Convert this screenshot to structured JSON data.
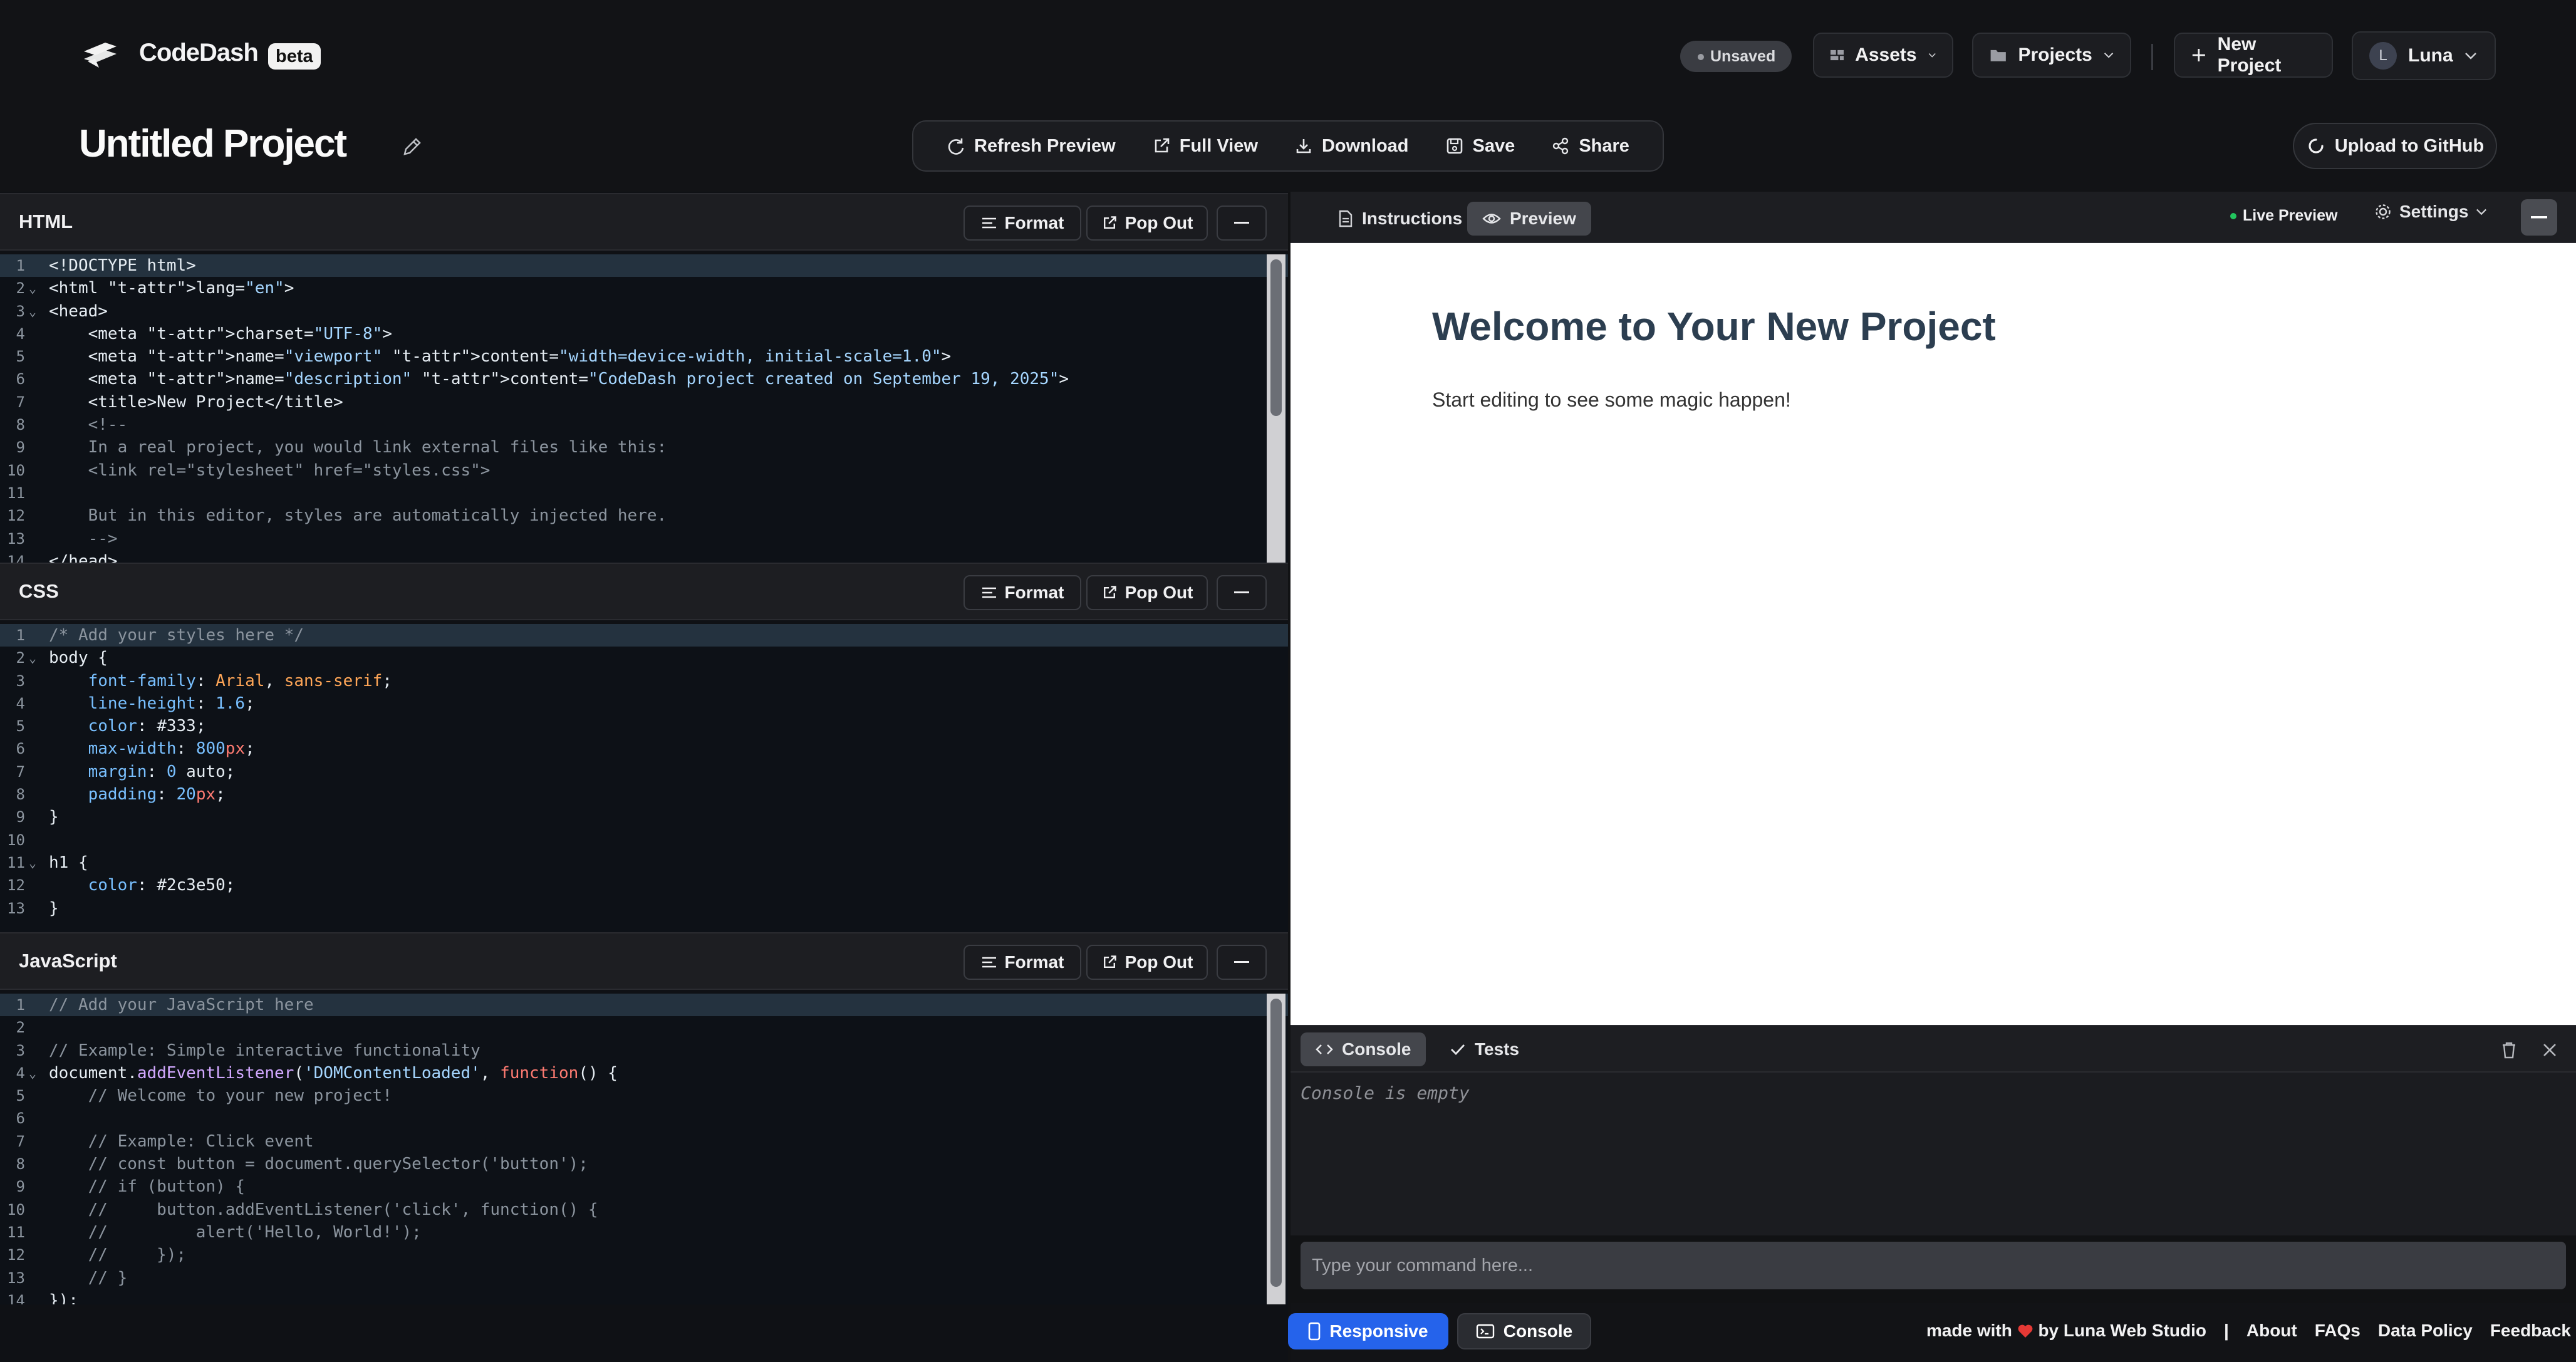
{
  "header": {
    "brand": "CodeDash",
    "beta": "beta",
    "status": "Unsaved",
    "assets": "Assets",
    "projects": "Projects",
    "new_project": "New Project",
    "user_initial": "L",
    "user_name": "Luna"
  },
  "project": {
    "title": "Untitled Project"
  },
  "toolbar": {
    "refresh": "Refresh Preview",
    "full_view": "Full View",
    "download": "Download",
    "save": "Save",
    "share": "Share",
    "upload": "Upload to GitHub"
  },
  "editors": {
    "format": "Format",
    "pop_out": "Pop Out",
    "html": {
      "title": "HTML",
      "lines": [
        "<!DOCTYPE html>",
        "<html lang=\"en\">",
        "<head>",
        "    <meta charset=\"UTF-8\">",
        "    <meta name=\"viewport\" content=\"width=device-width, initial-scale=1.0\">",
        "    <meta name=\"description\" content=\"CodeDash project created on September 19, 2025\">",
        "    <title>New Project</title>",
        "    <!--",
        "    In a real project, you would link external files like this:",
        "    <link rel=\"stylesheet\" href=\"styles.css\">",
        "",
        "    But in this editor, styles are automatically injected here.",
        "    -->",
        "</head>"
      ]
    },
    "css": {
      "title": "CSS",
      "lines": [
        "/* Add your styles here */",
        "body {",
        "    font-family: Arial, sans-serif;",
        "    line-height: 1.6;",
        "    color: #333;",
        "    max-width: 800px;",
        "    margin: 0 auto;",
        "    padding: 20px;",
        "}",
        "",
        "h1 {",
        "    color: #2c3e50;",
        "}"
      ]
    },
    "js": {
      "title": "JavaScript",
      "lines": [
        "// Add your JavaScript here",
        "",
        "// Example: Simple interactive functionality",
        "document.addEventListener('DOMContentLoaded', function() {",
        "    // Welcome to your new project!",
        "",
        "    // Example: Click event",
        "    // const button = document.querySelector('button');",
        "    // if (button) {",
        "    //     button.addEventListener('click', function() {",
        "    //         alert('Hello, World!');",
        "    //     });",
        "    // }",
        "});"
      ]
    }
  },
  "preview": {
    "tab_instructions": "Instructions",
    "tab_preview": "Preview",
    "live": "Live Preview",
    "settings": "Settings",
    "heading": "Welcome to Your New Project",
    "paragraph": "Start editing to see some magic happen!"
  },
  "console": {
    "tab_console": "Console",
    "tab_tests": "Tests",
    "empty": "Console is empty",
    "placeholder": "Type your command here..."
  },
  "footer": {
    "responsive": "Responsive",
    "console": "Console",
    "made_with_prefix": "made with",
    "made_with_suffix": "by Luna Web Studio",
    "separator": "|",
    "about": "About",
    "faqs": "FAQs",
    "data_policy": "Data Policy",
    "feedback": "Feedback"
  },
  "colors": {
    "accent": "#2563eb",
    "live_dot": "#22c55e",
    "heart": "#e53935"
  }
}
